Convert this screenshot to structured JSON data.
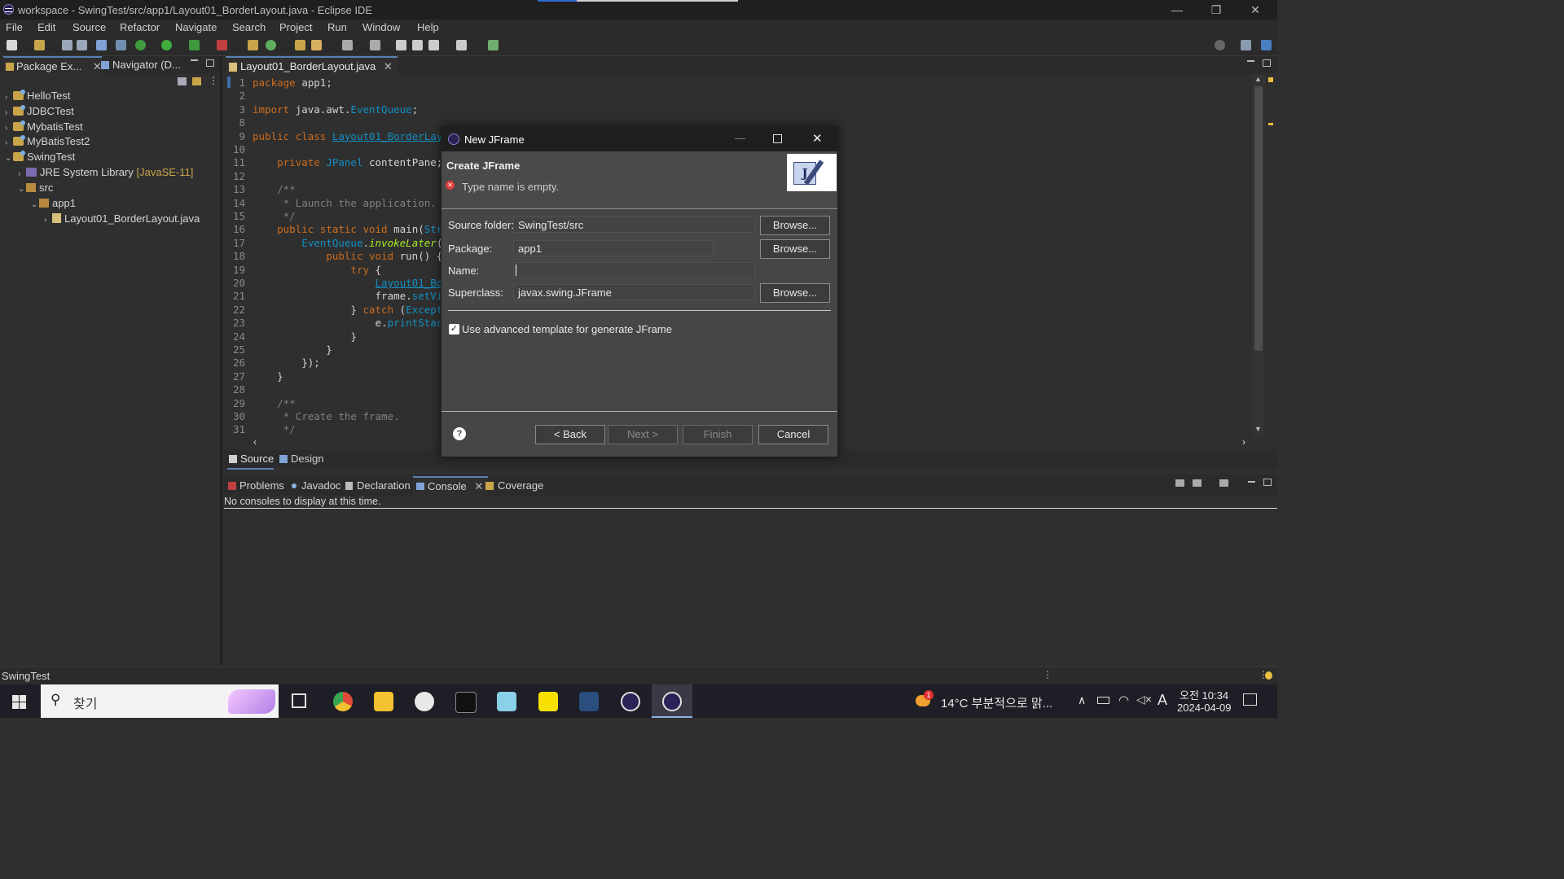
{
  "window": {
    "title": "workspace - SwingTest/src/app1/Layout01_BorderLayout.java - Eclipse IDE",
    "controls": [
      "—",
      "❐",
      "✕"
    ]
  },
  "menu": [
    "File",
    "Edit",
    "Source",
    "Refactor",
    "Navigate",
    "Search",
    "Project",
    "Run",
    "Window",
    "Help"
  ],
  "left_tabs": [
    {
      "label": "Package Ex...",
      "close": "✕"
    },
    {
      "label": "Navigator (D..."
    }
  ],
  "tree": [
    {
      "label": "HelloTest",
      "arrow": "›"
    },
    {
      "label": "JDBCTest",
      "arrow": "›"
    },
    {
      "label": "MybatisTest",
      "arrow": "›"
    },
    {
      "label": "MyBatisTest2",
      "arrow": "›"
    },
    {
      "label": "SwingTest",
      "arrow": "⌄"
    },
    {
      "label": "JRE System Library",
      "suffix": "[JavaSE-11]",
      "arrow": "›"
    },
    {
      "label": "src",
      "arrow": "⌄"
    },
    {
      "label": "app1",
      "arrow": "⌄"
    },
    {
      "label": "Layout01_BorderLayout.java",
      "arrow": "›"
    }
  ],
  "editor": {
    "tab_label": "Layout01_BorderLayout.java",
    "tab_close": "✕",
    "lines": [
      {
        "n": "1",
        "code": "package app1;"
      },
      {
        "n": "2",
        "code": ""
      },
      {
        "n": "3",
        "code": "import java.awt.EventQueue;"
      },
      {
        "n": "8",
        "code": ""
      },
      {
        "n": "9",
        "code": "public class Layout01_BorderLayo"
      },
      {
        "n": "10",
        "code": ""
      },
      {
        "n": "11",
        "code": "    private JPanel contentPane;"
      },
      {
        "n": "12",
        "code": ""
      },
      {
        "n": "13",
        "code": "    /**"
      },
      {
        "n": "14",
        "code": "     * Launch the application."
      },
      {
        "n": "15",
        "code": "     */"
      },
      {
        "n": "16",
        "code": "    public static void main(Stri"
      },
      {
        "n": "17",
        "code": "        EventQueue.invokeLater(n"
      },
      {
        "n": "18",
        "code": "            public void run() {"
      },
      {
        "n": "19",
        "code": "                try {"
      },
      {
        "n": "20",
        "code": "                    Layout01_Bor"
      },
      {
        "n": "21",
        "code": "                    frame.setVis"
      },
      {
        "n": "22",
        "code": "                } catch (Except"
      },
      {
        "n": "23",
        "code": "                    e.printStack"
      },
      {
        "n": "24",
        "code": "                }"
      },
      {
        "n": "25",
        "code": "            }"
      },
      {
        "n": "26",
        "code": "        });"
      },
      {
        "n": "27",
        "code": "    }"
      },
      {
        "n": "28",
        "code": ""
      },
      {
        "n": "29",
        "code": "    /**"
      },
      {
        "n": "30",
        "code": "     * Create the frame."
      },
      {
        "n": "31",
        "code": "     */"
      }
    ],
    "bottom_tabs": [
      "Source",
      "Design"
    ]
  },
  "bottom_panel": {
    "tabs": [
      "Problems",
      "Javadoc",
      "Declaration",
      "Console",
      "Coverage"
    ],
    "console_close": "✕",
    "message": "No consoles to display at this time."
  },
  "status": {
    "text": "SwingTest"
  },
  "dialog": {
    "title": "New JFrame",
    "header_title": "Create JFrame",
    "error": "Type name is empty.",
    "source_folder_label": "Source folder:",
    "source_folder_value": "SwingTest/src",
    "package_label": "Package:",
    "package_value": "app1",
    "name_label": "Name:",
    "name_value": "",
    "superclass_label": "Superclass:",
    "superclass_value": "javax.swing.JFrame",
    "browse": "Browse...",
    "checkbox_label": "Use advanced template for generate JFrame",
    "checkbox_checked": true,
    "help": "?",
    "back": "< Back",
    "next": "Next >",
    "finish": "Finish",
    "cancel": "Cancel"
  },
  "taskbar": {
    "search": "찾기",
    "weather": "14°C  부분적으로 맑...",
    "weather_badge": "1",
    "lang": "A",
    "time": "오전 10:34",
    "date": "2024-04-09"
  },
  "colors": {
    "accent": "#2d6bd3",
    "keyword": "#cc6c1d",
    "type": "#1290c3",
    "error": "#e04040"
  }
}
